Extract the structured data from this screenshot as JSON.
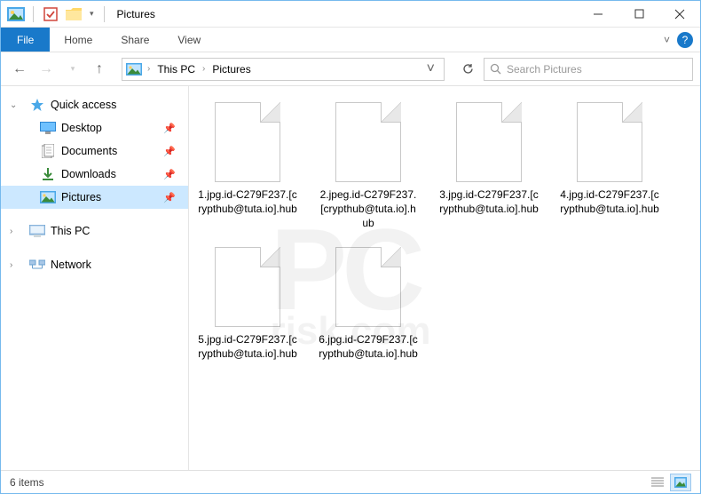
{
  "title": "Pictures",
  "ribbon": {
    "file": "File",
    "tabs": [
      "Home",
      "Share",
      "View"
    ]
  },
  "breadcrumb": {
    "items": [
      "This PC",
      "Pictures"
    ]
  },
  "search": {
    "placeholder": "Search Pictures"
  },
  "sidebar": {
    "quick_access": "Quick access",
    "items": [
      {
        "label": "Desktop",
        "pinned": true
      },
      {
        "label": "Documents",
        "pinned": true
      },
      {
        "label": "Downloads",
        "pinned": true
      },
      {
        "label": "Pictures",
        "pinned": true,
        "selected": true
      }
    ],
    "this_pc": "This PC",
    "network": "Network"
  },
  "files": [
    "1.jpg.id-C279F237.[crypthub@tuta.io].hub",
    "2.jpeg.id-C279F237.[crypthub@tuta.io].hub",
    "3.jpg.id-C279F237.[crypthub@tuta.io].hub",
    "4.jpg.id-C279F237.[crypthub@tuta.io].hub",
    "5.jpg.id-C279F237.[crypthub@tuta.io].hub",
    "6.jpg.id-C279F237.[crypthub@tuta.io].hub"
  ],
  "status": {
    "count": "6 items"
  },
  "watermark": {
    "main": "PC",
    "sub": "risk.com"
  }
}
